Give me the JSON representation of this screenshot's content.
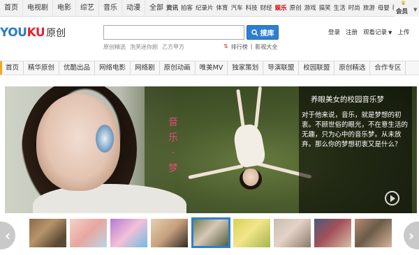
{
  "topbar": {
    "left_items": [
      "首页",
      "电视剧",
      "电影",
      "综艺",
      "音乐",
      "动漫",
      "全部"
    ],
    "right_items": [
      {
        "label": "资讯",
        "style": "bold"
      },
      {
        "label": "拍客",
        "style": "normal"
      },
      {
        "label": "纪录片",
        "style": "normal"
      },
      {
        "label": "体育",
        "style": "normal"
      },
      {
        "label": "汽车",
        "style": "normal"
      },
      {
        "label": "科技",
        "style": "normal"
      },
      {
        "label": "财经",
        "style": "normal"
      },
      {
        "label": "娱乐",
        "style": "red"
      },
      {
        "label": "原创",
        "style": "normal"
      },
      {
        "label": "游戏",
        "style": "normal"
      },
      {
        "label": "搞笑",
        "style": "normal"
      },
      {
        "label": "生活",
        "style": "normal"
      },
      {
        "label": "时尚",
        "style": "normal"
      },
      {
        "label": "旅游",
        "style": "normal"
      },
      {
        "label": "母婴",
        "style": "normal"
      },
      {
        "label": "教育",
        "style": "normal"
      }
    ],
    "member_label": "会员"
  },
  "header": {
    "logo_you": "YOU",
    "logo_ku": "KU",
    "logo_sub": "原创",
    "search_button": "搜库",
    "search_suggestions": [
      "原创精选",
      "泡芙迷你剧",
      "乙方甲方"
    ],
    "rank_label": "排行榜",
    "movie_label": "影视大全",
    "login": "登录",
    "register": "注册",
    "watch_history": "观看记录",
    "upload": "上传"
  },
  "channel_nav": [
    "首页",
    "精华原创",
    "优酷出品",
    "网络电影",
    "网络剧",
    "原创动画",
    "唯美MV",
    "独家策划",
    "导演联盟",
    "校园联盟",
    "原创精选",
    "合作专区"
  ],
  "banner": {
    "vertical_text": [
      "音",
      "乐",
      "·",
      "梦"
    ],
    "title": "养眼美女的校园音乐梦",
    "description": "对于他来说，音乐，就是梦想的初衷。不顾世俗的眼光，不在意生活的无趣，只为心中的音乐梦。从未放弃。那么你的梦想初衷又是什么？"
  },
  "thumbnails": {
    "count": 9,
    "selected_index": 4
  }
}
